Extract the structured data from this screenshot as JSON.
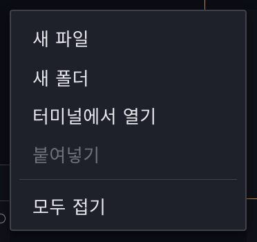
{
  "context_menu": {
    "items": [
      {
        "label": "새 파일",
        "enabled": true
      },
      {
        "label": "새 폴더",
        "enabled": true
      },
      {
        "label": "터미널에서 열기",
        "enabled": true
      },
      {
        "label": "붙여넣기",
        "enabled": false
      }
    ],
    "after_separator": [
      {
        "label": "모두 접기",
        "enabled": true
      }
    ]
  },
  "colors": {
    "menu_background": "#1e2129",
    "menu_border": "#3e424b",
    "text": "#e7e9ee",
    "disabled_text": "#6e727b",
    "accent_line": "#c98a3a"
  }
}
